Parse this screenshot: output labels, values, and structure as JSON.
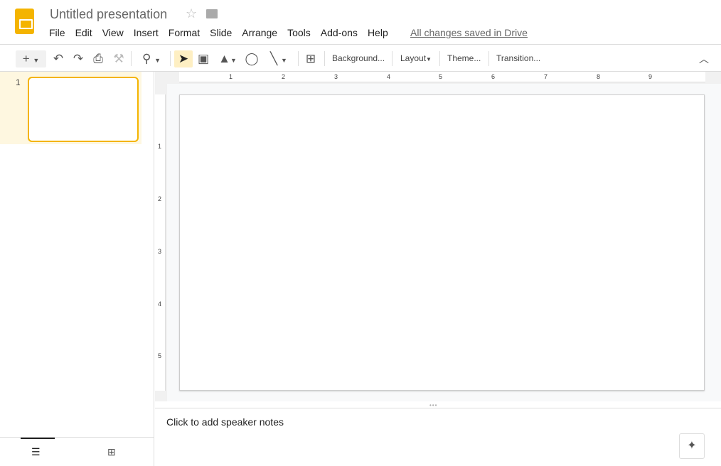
{
  "header": {
    "title": "Untitled presentation",
    "saved_status": "All changes saved in Drive",
    "menu": [
      "File",
      "Edit",
      "View",
      "Insert",
      "Format",
      "Slide",
      "Arrange",
      "Tools",
      "Add-ons",
      "Help"
    ]
  },
  "toolbar": {
    "background": "Background...",
    "layout": "Layout",
    "theme": "Theme...",
    "transition": "Transition..."
  },
  "filmstrip": {
    "slides": [
      {
        "number": "1"
      }
    ]
  },
  "rulers": {
    "horizontal": [
      "1",
      "2",
      "3",
      "4",
      "5",
      "6",
      "7",
      "8",
      "9"
    ],
    "vertical": [
      "1",
      "2",
      "3",
      "4",
      "5"
    ]
  },
  "notes": {
    "placeholder": "Click to add speaker notes"
  },
  "colors": {
    "accent": "#f4b400",
    "selection": "#fef7e0"
  }
}
